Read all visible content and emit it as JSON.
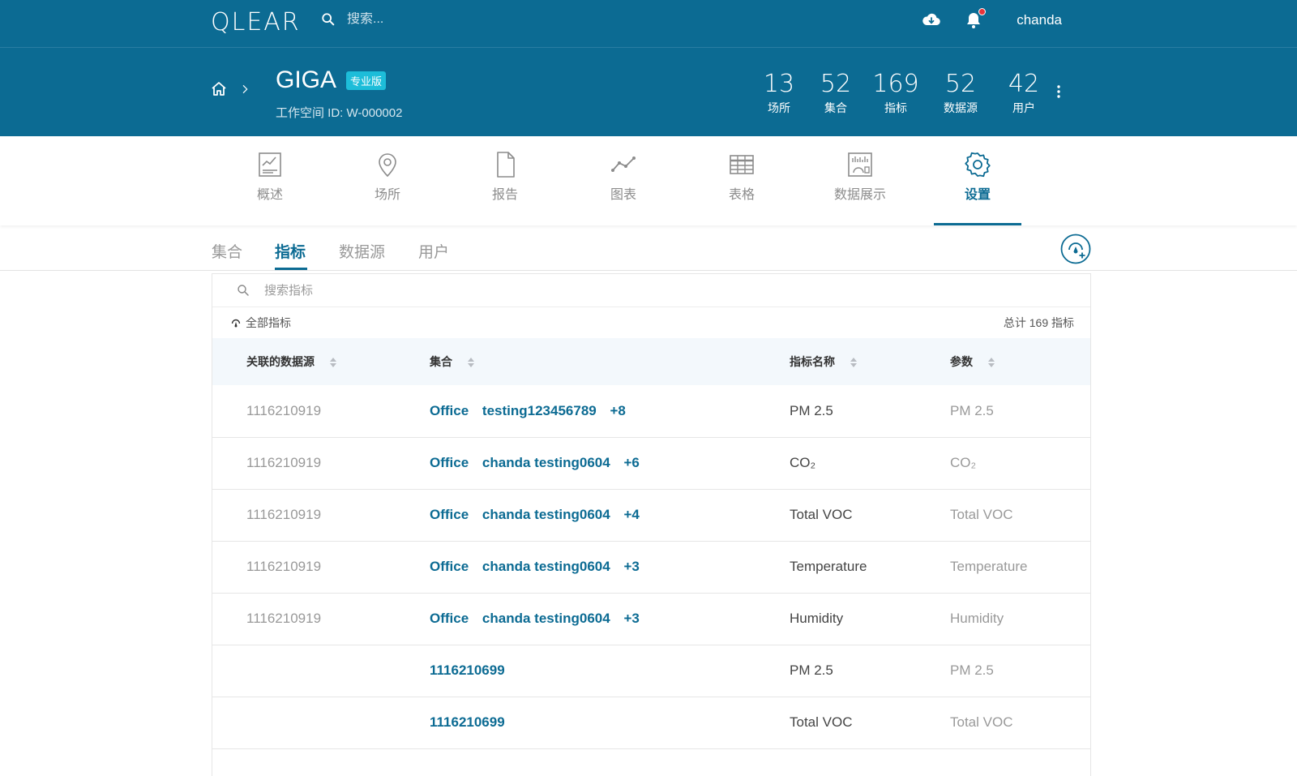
{
  "header": {
    "logo": "QLEAR",
    "search_placeholder": "搜索...",
    "user": "chanda"
  },
  "workspace": {
    "name": "GIGA",
    "badge": "专业版",
    "id_text": "工作空间 ID: W-000002"
  },
  "stats": [
    {
      "value": "13",
      "label": "场所"
    },
    {
      "value": "52",
      "label": "集合"
    },
    {
      "value": "169",
      "label": "指标"
    },
    {
      "value": "52",
      "label": "数据源"
    },
    {
      "value": "42",
      "label": "用户"
    }
  ],
  "nav": [
    {
      "label": "概述",
      "icon": "overview-icon"
    },
    {
      "label": "场所",
      "icon": "location-icon"
    },
    {
      "label": "报告",
      "icon": "report-icon"
    },
    {
      "label": "图表",
      "icon": "chart-icon"
    },
    {
      "label": "表格",
      "icon": "table-icon"
    },
    {
      "label": "数据展示",
      "icon": "display-icon"
    },
    {
      "label": "设置",
      "icon": "settings-icon",
      "active": true
    }
  ],
  "subtabs": [
    {
      "label": "集合"
    },
    {
      "label": "指标",
      "active": true
    },
    {
      "label": "数据源"
    },
    {
      "label": "用户"
    }
  ],
  "panel": {
    "search_placeholder": "搜索指标",
    "filter_label": "全部指标",
    "total_text": "总计 169 指标"
  },
  "table": {
    "headers": [
      "关联的数据源",
      "集合",
      "指标名称",
      "参数"
    ],
    "rows": [
      {
        "source": "1116210919",
        "collections": [
          "Office",
          "testing123456789",
          "+8"
        ],
        "name": "PM 2.5",
        "param": "PM 2.5"
      },
      {
        "source": "1116210919",
        "collections": [
          "Office",
          "chanda testing0604",
          "+6"
        ],
        "name": "CO₂",
        "param": "CO₂"
      },
      {
        "source": "1116210919",
        "collections": [
          "Office",
          "chanda testing0604",
          "+4"
        ],
        "name": "Total VOC",
        "param": "Total VOC"
      },
      {
        "source": "1116210919",
        "collections": [
          "Office",
          "chanda testing0604",
          "+3"
        ],
        "name": "Temperature",
        "param": "Temperature"
      },
      {
        "source": "1116210919",
        "collections": [
          "Office",
          "chanda testing0604",
          "+3"
        ],
        "name": "Humidity",
        "param": "Humidity"
      },
      {
        "source": "",
        "collections": [
          "1116210699"
        ],
        "name": "PM 2.5",
        "param": "PM 2.5"
      },
      {
        "source": "",
        "collections": [
          "1116210699"
        ],
        "name": "Total VOC",
        "param": "Total VOC"
      }
    ]
  },
  "colors": {
    "brand": "#0c6b93",
    "badge": "#1dbdd9",
    "notification": "#e8343a"
  }
}
